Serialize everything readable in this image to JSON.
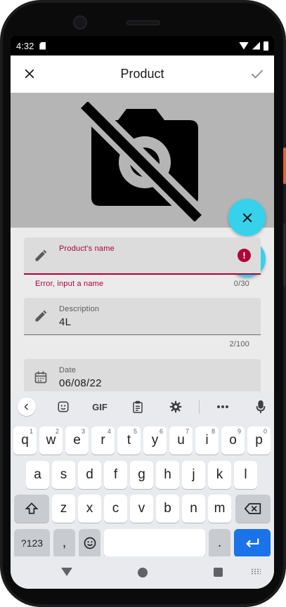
{
  "status_bar": {
    "time": "4:32"
  },
  "app_bar": {
    "title": "Product"
  },
  "form": {
    "name": {
      "label": "Product's name",
      "value": "",
      "error": "Error, input a name",
      "counter": "0/30"
    },
    "description": {
      "label": "Description",
      "value": "4L",
      "counter": "2/100"
    },
    "date": {
      "label": "Date",
      "value": "06/08/22"
    }
  },
  "keyboard": {
    "toolbar": {
      "gif_label": "GIF"
    },
    "row1": [
      {
        "k": "q",
        "h": "1"
      },
      {
        "k": "w",
        "h": "2"
      },
      {
        "k": "e",
        "h": "3"
      },
      {
        "k": "r",
        "h": "4"
      },
      {
        "k": "t",
        "h": "5"
      },
      {
        "k": "y",
        "h": "6"
      },
      {
        "k": "u",
        "h": "7"
      },
      {
        "k": "i",
        "h": "8"
      },
      {
        "k": "o",
        "h": "9"
      },
      {
        "k": "p",
        "h": "0"
      }
    ],
    "row2": [
      "a",
      "s",
      "d",
      "f",
      "g",
      "h",
      "j",
      "k",
      "l"
    ],
    "row3": [
      "z",
      "x",
      "c",
      "v",
      "b",
      "n",
      "m"
    ],
    "symbols_key": "?123",
    "comma_key": ",",
    "period_key": "."
  },
  "colors": {
    "accent": "#36d1ea",
    "error": "#b0003a",
    "enter": "#1a73e8"
  },
  "icons": [
    "close-icon",
    "check-icon",
    "no-photography-icon",
    "camera-icon",
    "edit-icon",
    "error-icon",
    "calendar-icon",
    "emoji-sticker-icon",
    "clipboard-icon",
    "gear-icon",
    "more-icon",
    "mic-icon",
    "shift-icon",
    "backspace-icon",
    "emoji-icon",
    "enter-icon"
  ]
}
